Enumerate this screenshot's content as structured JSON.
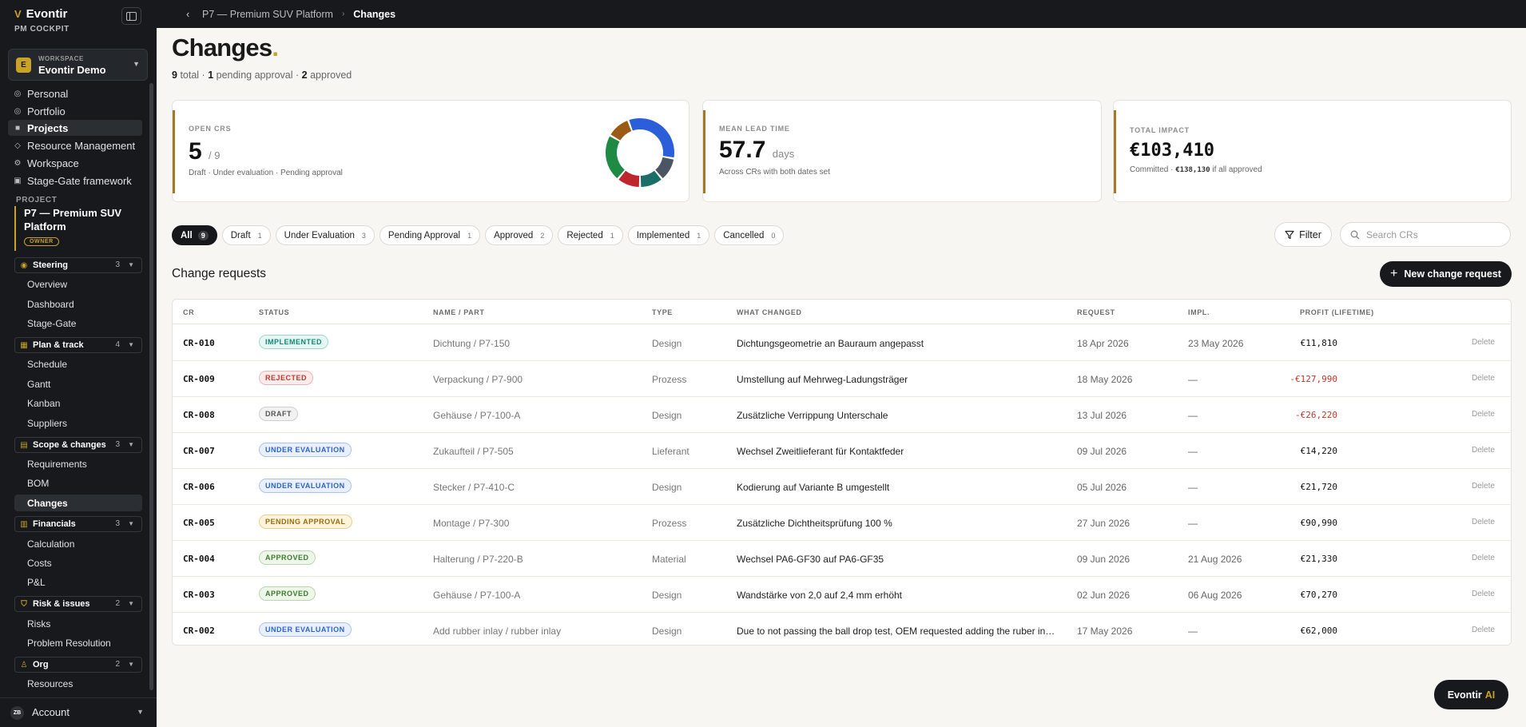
{
  "app": {
    "name": "Evontir",
    "subtitle": "PM COCKPIT",
    "accent": "#c9a227"
  },
  "workspace": {
    "label": "WORKSPACE",
    "name": "Evontir Demo",
    "initial": "E"
  },
  "nav": [
    {
      "label": "Personal",
      "icon": "user-icon"
    },
    {
      "label": "Portfolio",
      "icon": "portfolio-icon"
    },
    {
      "label": "Projects",
      "icon": "projects-icon",
      "active": true
    },
    {
      "label": "Resource Management",
      "icon": "resource-icon"
    },
    {
      "label": "Workspace",
      "icon": "workspace-icon"
    },
    {
      "label": "Stage-Gate framework",
      "icon": "stagegate-icon"
    }
  ],
  "project": {
    "label": "PROJECT",
    "name": "P7 — Premium SUV Platform",
    "role": "OWNER"
  },
  "groups": {
    "steering": {
      "label": "Steering",
      "count": "3",
      "items": [
        "Overview",
        "Dashboard",
        "Stage-Gate"
      ]
    },
    "plan": {
      "label": "Plan & track",
      "count": "4",
      "items": [
        "Schedule",
        "Gantt",
        "Kanban",
        "Suppliers"
      ]
    },
    "scope": {
      "label": "Scope & changes",
      "count": "3",
      "items": [
        "Requirements",
        "BOM",
        "Changes"
      ]
    },
    "financials": {
      "label": "Financials",
      "count": "3",
      "items": [
        "Calculation",
        "Costs",
        "P&L"
      ]
    },
    "risk": {
      "label": "Risk & issues",
      "count": "2",
      "items": [
        "Risks",
        "Problem Resolution"
      ]
    },
    "org": {
      "label": "Org",
      "count": "2",
      "items": [
        "Resources"
      ]
    }
  },
  "account": {
    "initials": "ZB",
    "label": "Account"
  },
  "breadcrumb": {
    "parent": "P7 — Premium SUV Platform",
    "current": "Changes"
  },
  "page": {
    "title": "Changes",
    "total": "9",
    "total_label": "total",
    "pending": "1",
    "pending_label": "pending approval",
    "approved": "2",
    "approved_label": "approved"
  },
  "cards": {
    "open": {
      "label": "OPEN CRS",
      "value": "5",
      "of": "/ 9",
      "note": "Draft · Under evaluation · Pending approval"
    },
    "lead": {
      "label": "MEAN LEAD TIME",
      "value": "57.7",
      "unit": "days",
      "note": "Across CRs with both dates set"
    },
    "impact": {
      "label": "TOTAL IMPACT",
      "value": "€103,410",
      "note_prefix": "Committed ·",
      "note_value": "€138,130",
      "note_suffix": "if all approved"
    }
  },
  "donut": [
    {
      "status": "Draft",
      "value": 1,
      "color": "#4b5563"
    },
    {
      "status": "Under Evaluation",
      "value": 3,
      "color": "#2b5fd9"
    },
    {
      "status": "Pending Approval",
      "value": 1,
      "color": "#9a5b17"
    },
    {
      "status": "Approved",
      "value": 2,
      "color": "#1f8a43"
    },
    {
      "status": "Rejected",
      "value": 1,
      "color": "#c0262d"
    },
    {
      "status": "Implemented",
      "value": 1,
      "color": "#1b6f68"
    }
  ],
  "filters": [
    {
      "label": "All",
      "count": "9",
      "active": true
    },
    {
      "label": "Draft",
      "count": "1"
    },
    {
      "label": "Under Evaluation",
      "count": "3"
    },
    {
      "label": "Pending Approval",
      "count": "1"
    },
    {
      "label": "Approved",
      "count": "2"
    },
    {
      "label": "Rejected",
      "count": "1"
    },
    {
      "label": "Implemented",
      "count": "1"
    },
    {
      "label": "Cancelled",
      "count": "0"
    }
  ],
  "toolbar": {
    "filter_label": "Filter",
    "search_placeholder": "Search CRs",
    "new_label": "New change request"
  },
  "section_title": "Change requests",
  "columns": {
    "cr": "CR",
    "status": "STATUS",
    "name": "NAME / PART",
    "type": "TYPE",
    "what": "WHAT CHANGED",
    "request": "REQUEST",
    "impl": "IMPL.",
    "profit": "PROFIT (LIFETIME)"
  },
  "rows": [
    {
      "cr": "CR-010",
      "status": "IMPLEMENTED",
      "cls": "b-implemented",
      "name": "Dichtung / P7-150",
      "type": "Design",
      "what": "Dichtungsgeometrie an Bauraum angepasst",
      "request": "18 Apr 2026",
      "impl": "23 May 2026",
      "profit": "€11,810",
      "neg": false,
      "del": "Delete"
    },
    {
      "cr": "CR-009",
      "status": "REJECTED",
      "cls": "b-rejected",
      "name": "Verpackung / P7-900",
      "type": "Prozess",
      "what": "Umstellung auf Mehrweg-Ladungsträger",
      "request": "18 May 2026",
      "impl": "—",
      "profit": "-€127,990",
      "neg": true,
      "del": "Delete"
    },
    {
      "cr": "CR-008",
      "status": "DRAFT",
      "cls": "b-draft",
      "name": "Gehäuse / P7-100-A",
      "type": "Design",
      "what": "Zusätzliche Verrippung Unterschale",
      "request": "13 Jul 2026",
      "impl": "—",
      "profit": "-€26,220",
      "neg": true,
      "del": "Delete"
    },
    {
      "cr": "CR-007",
      "status": "UNDER EVALUATION",
      "cls": "b-eval",
      "name": "Zukaufteil / P7-505",
      "type": "Lieferant",
      "what": "Wechsel Zweitlieferant für Kontaktfeder",
      "request": "09 Jul 2026",
      "impl": "—",
      "profit": "€14,220",
      "neg": false,
      "del": "Delete"
    },
    {
      "cr": "CR-006",
      "status": "UNDER EVALUATION",
      "cls": "b-eval",
      "name": "Stecker / P7-410-C",
      "type": "Design",
      "what": "Kodierung auf Variante B umgestellt",
      "request": "05 Jul 2026",
      "impl": "—",
      "profit": "€21,720",
      "neg": false,
      "del": "Delete"
    },
    {
      "cr": "CR-005",
      "status": "PENDING APPROVAL",
      "cls": "b-pending",
      "name": "Montage / P7-300",
      "type": "Prozess",
      "what": "Zusätzliche Dichtheitsprüfung 100 %",
      "request": "27 Jun 2026",
      "impl": "—",
      "profit": "€90,990",
      "neg": false,
      "del": "Delete"
    },
    {
      "cr": "CR-004",
      "status": "APPROVED",
      "cls": "b-approved",
      "name": "Halterung / P7-220-B",
      "type": "Material",
      "what": "Wechsel PA6-GF30 auf PA6-GF35",
      "request": "09 Jun 2026",
      "impl": "21 Aug 2026",
      "profit": "€21,330",
      "neg": false,
      "del": "Delete"
    },
    {
      "cr": "CR-003",
      "status": "APPROVED",
      "cls": "b-approved",
      "name": "Gehäuse / P7-100-A",
      "type": "Design",
      "what": "Wandstärke von 2,0 auf 2,4 mm erhöht",
      "request": "02 Jun 2026",
      "impl": "06 Aug 2026",
      "profit": "€70,270",
      "neg": false,
      "del": "Delete"
    },
    {
      "cr": "CR-002",
      "status": "UNDER EVALUATION",
      "cls": "b-eval",
      "name": "Add rubber inlay / rubber inlay",
      "type": "Design",
      "what": "Due to not passing the ball drop test, OEM requested adding the ruber inla...",
      "request": "17 May 2026",
      "impl": "—",
      "profit": "€62,000",
      "neg": false,
      "del": "Delete"
    }
  ],
  "ai": {
    "brand": "Evontir",
    "suffix": "AI"
  }
}
